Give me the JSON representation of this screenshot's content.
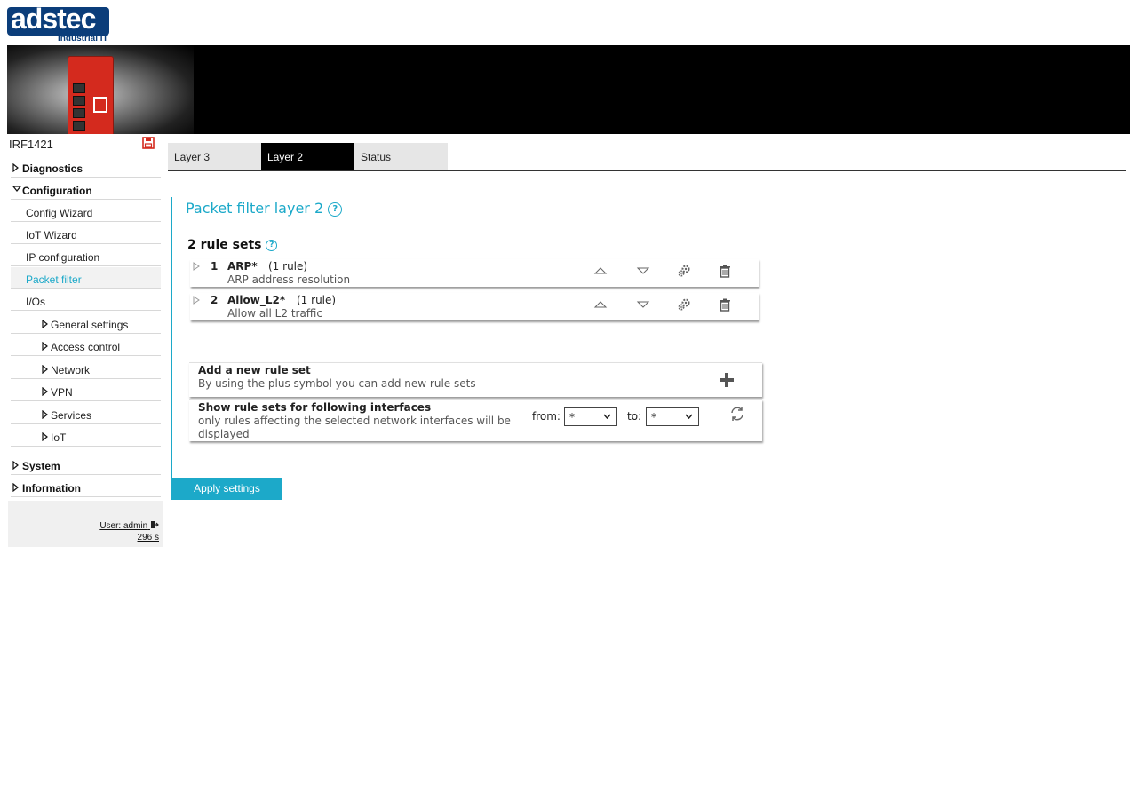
{
  "logo": {
    "text": "adstec",
    "subtitle": "Industrial IT"
  },
  "device": {
    "name": "IRF1421"
  },
  "nav": {
    "diagnostics": "Diagnostics",
    "configuration": "Configuration",
    "config_wizard": "Config Wizard",
    "iot_wizard": "IoT Wizard",
    "ip_configuration": "IP configuration",
    "packet_filter": "Packet filter",
    "ios": "I/Os",
    "general_settings": "General settings",
    "access_control": "Access control",
    "network": "Network",
    "vpn": "VPN",
    "services": "Services",
    "iot": "IoT",
    "system": "System",
    "information": "Information"
  },
  "user": {
    "label": "User: admin",
    "session": "296 s"
  },
  "tabs": [
    "Layer 3",
    "Layer 2",
    "Status"
  ],
  "page": {
    "title": "Packet filter layer 2",
    "count_label": "2 rule sets",
    "help_symbol": "?"
  },
  "rules": [
    {
      "num": "1",
      "name": "ARP*",
      "count": "(1 rule)",
      "desc": "ARP address resolution"
    },
    {
      "num": "2",
      "name": "Allow_L2*",
      "count": "(1 rule)",
      "desc": "Allow all L2 traffic"
    }
  ],
  "add_panel": {
    "title": "Add a new rule set",
    "desc": "By using the plus symbol you can add new rule sets"
  },
  "filter_panel": {
    "title": "Show rule sets for following interfaces",
    "desc": "only rules affecting the selected network interfaces will be displayed",
    "from_label": "from:",
    "from_value": "*",
    "to_label": "to:",
    "to_value": "*"
  },
  "apply_label": "Apply settings",
  "colors": {
    "accent": "#1ca9c9",
    "brand_blue": "#0b3d7a",
    "device_red": "#d42a1e"
  }
}
